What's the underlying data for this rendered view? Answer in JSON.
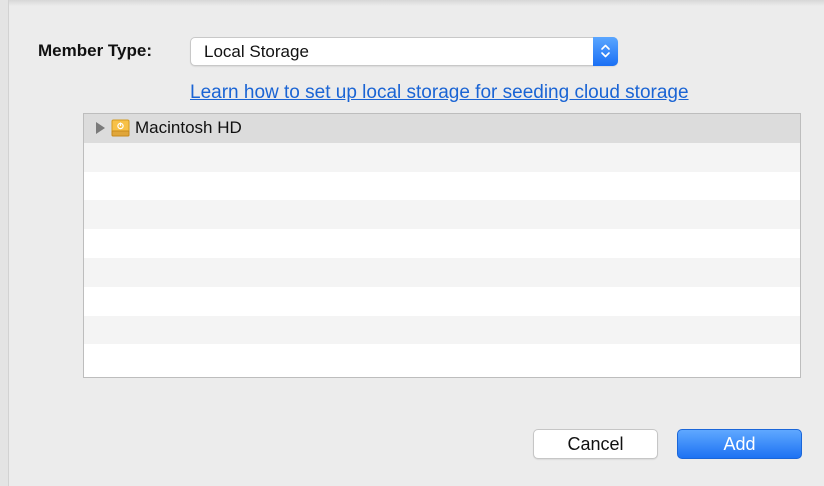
{
  "member": {
    "label": "Member Type:",
    "selected_value": "Local Storage"
  },
  "help_link": "Learn how to set up local storage for seeding cloud storage",
  "volumes": [
    {
      "name": "Macintosh HD",
      "icon": "internal-disk-icon"
    }
  ],
  "buttons": {
    "cancel": "Cancel",
    "add": "Add"
  },
  "colors": {
    "accent": "#1d72f3",
    "link": "#1a64d4",
    "selected_row": "#dcdcdc"
  }
}
